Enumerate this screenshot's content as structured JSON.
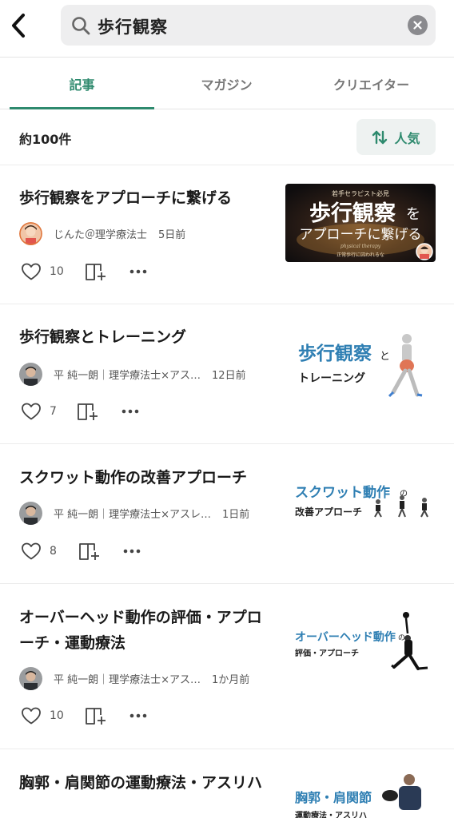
{
  "search": {
    "query": "歩行観察"
  },
  "tabs": [
    {
      "label": "記事",
      "active": true
    },
    {
      "label": "マガジン",
      "active": false
    },
    {
      "label": "クリエイター",
      "active": false
    }
  ],
  "results": {
    "count": "約100件",
    "sort_label": "人気"
  },
  "colors": {
    "accent": "#2e8a6e",
    "search_bg": "#eeeeef",
    "sort_bg": "#eef2f1"
  },
  "articles": [
    {
      "title": "歩行観察をアプローチに繋げる",
      "author": "じんた＠理学療法士",
      "date": "5日前",
      "likes": "10",
      "thumb": {
        "top": "若手セラピスト必見",
        "main": "歩行観察",
        "main2": "を",
        "sub": "アプローチに繋げる",
        "script": "physical therapy",
        "foot": "正常歩行に囚われるな"
      }
    },
    {
      "title": "歩行観察とトレーニング",
      "author": "平 純一朗｜理学療法士×アス…",
      "date": "12日前",
      "likes": "7",
      "thumb": {
        "main": "歩行観察",
        "main2": "と",
        "sub": "トレーニング"
      }
    },
    {
      "title": "スクワット動作の改善アプローチ",
      "author": "平 純一朗｜理学療法士×アスレ…",
      "date": "1日前",
      "likes": "8",
      "thumb": {
        "main": "スクワット動作",
        "main2": "の",
        "sub": "改善アプローチ"
      }
    },
    {
      "title": "オーバーヘッド動作の評価・アプローチ・運動療法",
      "author": "平 純一朗｜理学療法士×アス…",
      "date": "1か月前",
      "likes": "10",
      "thumb": {
        "main": "オーバーヘッド動作",
        "main2": "の",
        "sub": "評価・アプローチ"
      }
    },
    {
      "title": "胸郭・肩関節の運動療法・アスリハ",
      "thumb": {
        "main": "胸郭・肩関節",
        "sub": "運動療法・アスリハ"
      }
    }
  ]
}
